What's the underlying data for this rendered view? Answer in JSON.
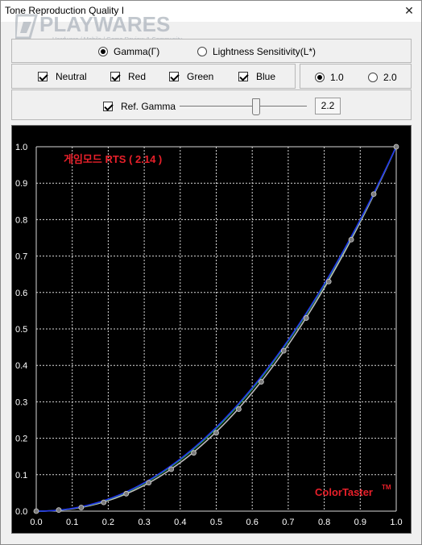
{
  "window": {
    "title": "Tone Reproduction Quality I",
    "close_glyph": "✕"
  },
  "watermark": {
    "brand": "PLAYWARES",
    "tagline": "Hardware / Mobile / Game Review & Community"
  },
  "mode": {
    "options": [
      {
        "label": "Gamma(Γ)",
        "selected": true
      },
      {
        "label": "Lightness Sensitivity(L*)",
        "selected": false
      }
    ]
  },
  "channels": [
    {
      "label": "Neutral",
      "checked": true
    },
    {
      "label": "Red",
      "checked": true
    },
    {
      "label": "Green",
      "checked": true
    },
    {
      "label": "Blue",
      "checked": true
    }
  ],
  "scale": {
    "options": [
      {
        "label": "1.0",
        "selected": true
      },
      {
        "label": "2.0",
        "selected": false
      }
    ]
  },
  "ref_gamma": {
    "label": "Ref. Gamma",
    "checked": true,
    "value": "2.2",
    "slider_min": 1.0,
    "slider_max": 3.0,
    "slider_value": 2.2
  },
  "chart_data": {
    "type": "line",
    "annotation": "게임모드 RTS ( 2.14 )",
    "watermark_text": "ColorTaster",
    "watermark_sup": "TM",
    "xlim": [
      0.0,
      1.0
    ],
    "ylim": [
      0.0,
      1.0
    ],
    "x_ticks": [
      "0.0",
      "0.1",
      "0.2",
      "0.3",
      "0.4",
      "0.5",
      "0.6",
      "0.7",
      "0.8",
      "0.9",
      "1.0"
    ],
    "y_ticks": [
      "0.0",
      "0.1",
      "0.2",
      "0.3",
      "0.4",
      "0.5",
      "0.6",
      "0.7",
      "0.8",
      "0.9",
      "1.0"
    ],
    "grid": true,
    "measured_points": {
      "x": [
        0.0,
        0.0625,
        0.125,
        0.1875,
        0.25,
        0.3125,
        0.375,
        0.4375,
        0.5,
        0.5625,
        0.625,
        0.6875,
        0.75,
        0.8125,
        0.875,
        0.9375,
        1.0
      ],
      "y": [
        0.0,
        0.003,
        0.01,
        0.024,
        0.048,
        0.078,
        0.115,
        0.16,
        0.215,
        0.28,
        0.355,
        0.44,
        0.53,
        0.63,
        0.745,
        0.87,
        1.0
      ]
    },
    "curves": [
      {
        "color": "#bbbbbb",
        "gamma": 2.2
      },
      {
        "color": "#2ba84a",
        "gamma": 2.14
      },
      {
        "color": "#2233ee",
        "gamma": 2.12
      }
    ],
    "colors": {
      "annotation": "#e8202a",
      "watermark": "#e8202a",
      "grid": "#d8d8d8",
      "axis_text": "#ffffff",
      "point": "#7b7b7b"
    }
  }
}
